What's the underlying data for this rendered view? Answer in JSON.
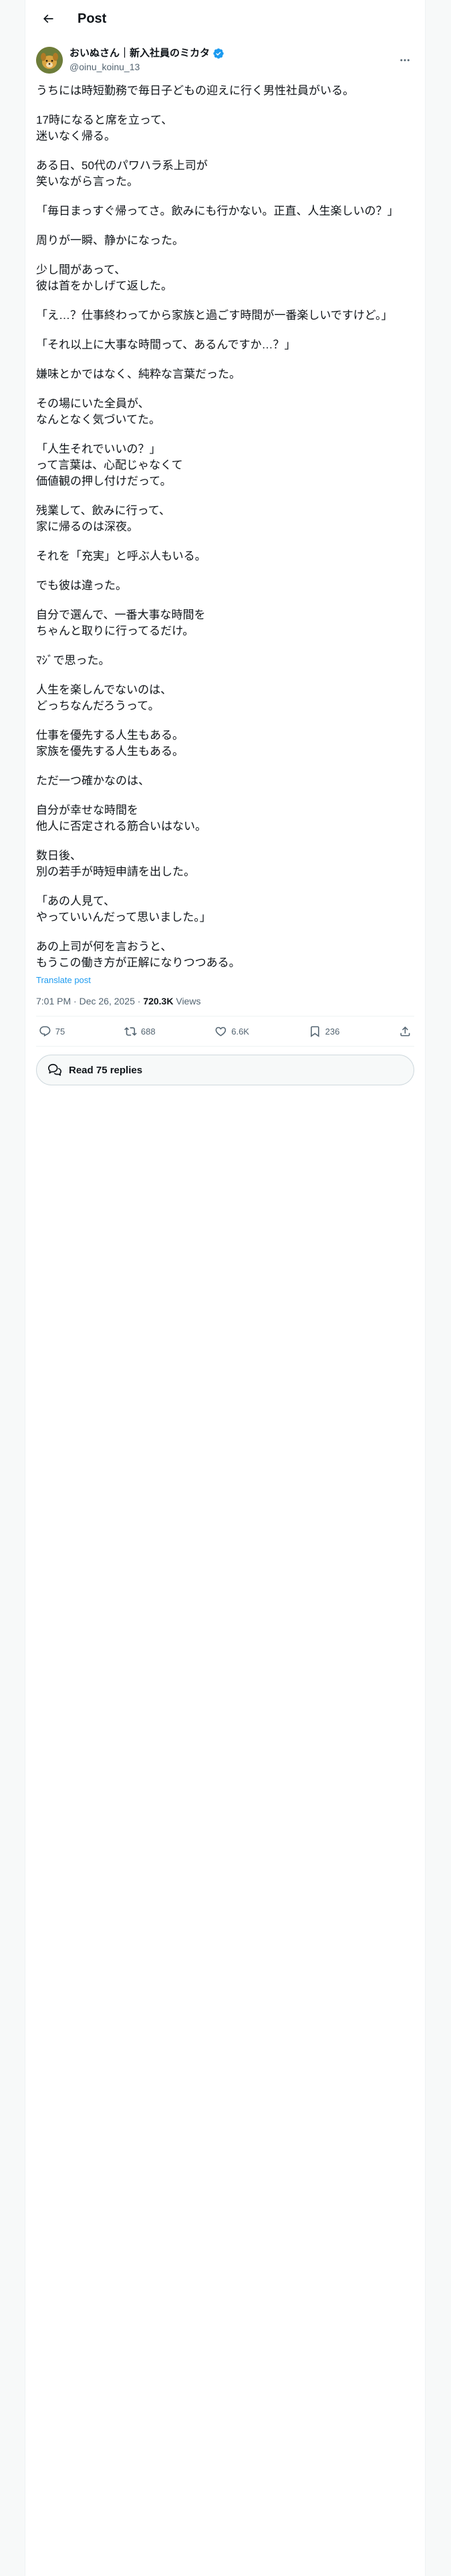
{
  "header": {
    "title": "Post"
  },
  "author": {
    "display_name": "おいぬさん｜新入社員のミカタ",
    "handle": "@oinu_koinu_13",
    "verified_color": "#1d9bf0"
  },
  "post": {
    "paragraphs": [
      "うちには時短勤務で毎日子どもの迎えに行く男性社員がいる。",
      "17時になると席を立って、\n迷いなく帰る。",
      "ある日、50代のパワハラ系上司が\n笑いながら言った。",
      "「毎日まっすぐ帰ってさ。飲みにも行かない。正直、人生楽しいの？」",
      "周りが一瞬、静かになった。",
      "少し間があって、\n彼は首をかしげて返した。",
      "「え…？仕事終わってから家族と過ごす時間が一番楽しいですけど。」",
      "「それ以上に大事な時間って、あるんですか…？」",
      "嫌味とかではなく、純粋な言葉だった。",
      "その場にいた全員が、\nなんとなく気づいてた。",
      "「人生それでいいの？」\nって言葉は、心配じゃなくて\n価値観の押し付けだって。",
      "残業して、飲みに行って、\n家に帰るのは深夜。",
      "それを「充実」と呼ぶ人もいる。",
      "でも彼は違った。",
      "自分で選んで、一番大事な時間を\nちゃんと取りに行ってるだけ。",
      "ﾏｼﾞで思った。",
      "人生を楽しんでないのは、\nどっちなんだろうって。",
      "仕事を優先する人生もある。\n家族を優先する人生もある。",
      "ただ一つ確かなのは、",
      "自分が幸せな時間を\n他人に否定される筋合いはない。",
      "数日後、\n別の若手が時短申請を出した。",
      "「あの人見て、\nやっていいんだって思いました。」",
      "あの上司が何を言おうと、\nもうこの働き方が正解になりつつある。"
    ],
    "translate_label": "Translate post",
    "time": "7:01 PM · Dec 26, 2025 · ",
    "views_count": "720.3K",
    "views_label": " Views"
  },
  "actions": {
    "replies": "75",
    "reposts": "688",
    "likes": "6.6K",
    "bookmarks": "236"
  },
  "read_replies_label": "Read 75 replies",
  "colors": {
    "accent": "#1d9bf0",
    "muted": "#536471",
    "text": "#0f1419"
  }
}
